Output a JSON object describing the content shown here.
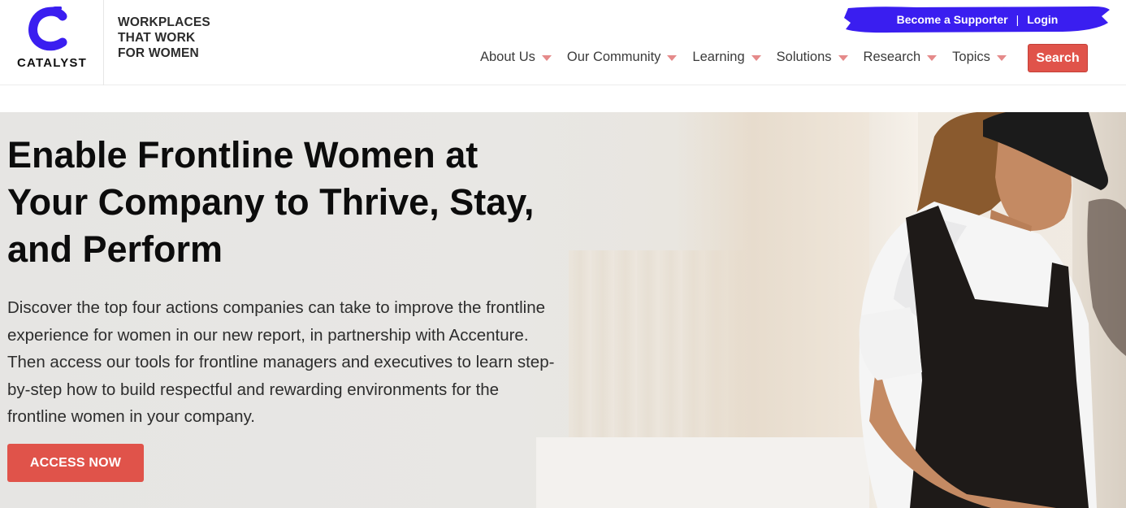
{
  "brand": {
    "name": "CATALYST",
    "tagline": [
      "WORKPLACES",
      "THAT WORK",
      "FOR WOMEN"
    ],
    "accent_color": "#3a1ef0"
  },
  "utility": {
    "supporter_label": "Become a Supporter",
    "separator": "|",
    "login_label": "Login"
  },
  "nav": {
    "items": [
      {
        "label": "About Us"
      },
      {
        "label": "Our Community"
      },
      {
        "label": "Learning"
      },
      {
        "label": "Solutions"
      },
      {
        "label": "Research"
      },
      {
        "label": "Topics"
      }
    ],
    "search_label": "Search",
    "caret_color": "#e58a8a",
    "button_color": "#e0534a"
  },
  "hero": {
    "title": "Enable Frontline Women at Your Company to Thrive, Stay, and Perform",
    "body": "Discover the top four actions companies can take to improve the frontline experience for women in our new report, in partnership with Accenture. Then access our tools for frontline managers and executives to learn step-by-step how to build respectful and rewarding environments for the frontline women in your company.",
    "cta_label": "ACCESS NOW",
    "image_icon": "frontline-worker-photo"
  }
}
